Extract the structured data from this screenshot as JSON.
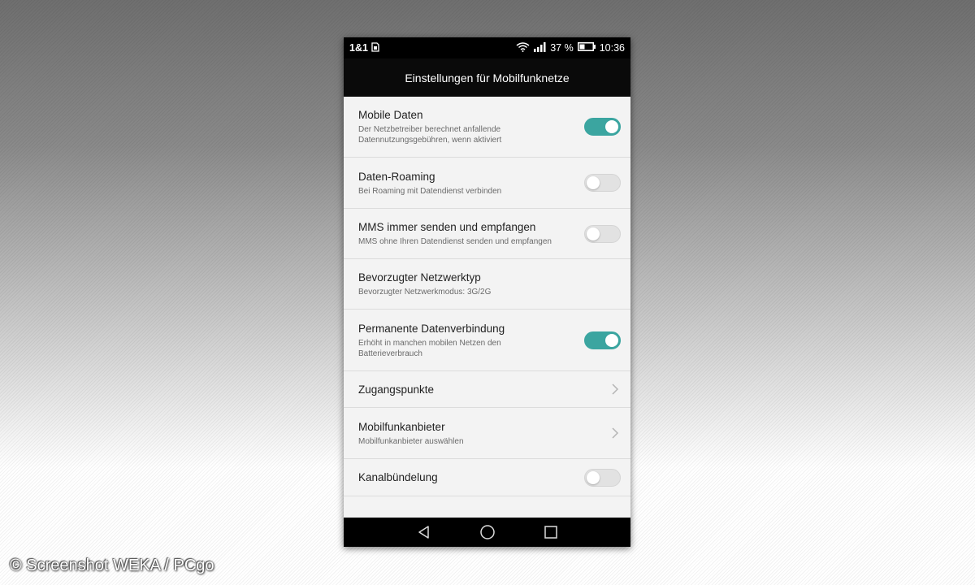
{
  "status": {
    "carrier": "1&1",
    "battery_percent": "37 %",
    "time": "10:36",
    "icons": [
      "sim-icon",
      "wifi-icon",
      "signal-icon",
      "battery-icon"
    ]
  },
  "header": {
    "title": "Einstellungen für Mobilfunknetze"
  },
  "settings": [
    {
      "title": "Mobile Daten",
      "subtitle": "Der Netzbetreiber berechnet anfallende Datennutzungsgebühren, wenn aktiviert",
      "control": "toggle",
      "on": true
    },
    {
      "title": "Daten-Roaming",
      "subtitle": "Bei Roaming mit Datendienst verbinden",
      "control": "toggle",
      "on": false
    },
    {
      "title": "MMS immer senden und empfangen",
      "subtitle": "MMS ohne Ihren Datendienst senden und empfangen",
      "control": "toggle",
      "on": false
    },
    {
      "title": "Bevorzugter Netzwerktyp",
      "subtitle": "Bevorzugter Netzwerkmodus: 3G/2G",
      "control": "none"
    },
    {
      "title": "Permanente Datenverbindung",
      "subtitle": "Erhöht in manchen mobilen Netzen den Batterieverbrauch",
      "control": "toggle",
      "on": true
    },
    {
      "title": "Zugangspunkte",
      "subtitle": "",
      "control": "chevron"
    },
    {
      "title": "Mobilfunkanbieter",
      "subtitle": "Mobilfunkanbieter auswählen",
      "control": "chevron"
    },
    {
      "title": "Kanalbündelung",
      "subtitle": "",
      "control": "toggle",
      "on": false
    }
  ],
  "navigation": {
    "icons": [
      "back-icon",
      "home-icon",
      "recents-icon"
    ]
  },
  "watermark": "© Screenshot WEKA / PCgo",
  "colors": {
    "accent": "#3ba5a0",
    "toggle_off": "#e2e2e2",
    "status_bar": "#000000"
  }
}
